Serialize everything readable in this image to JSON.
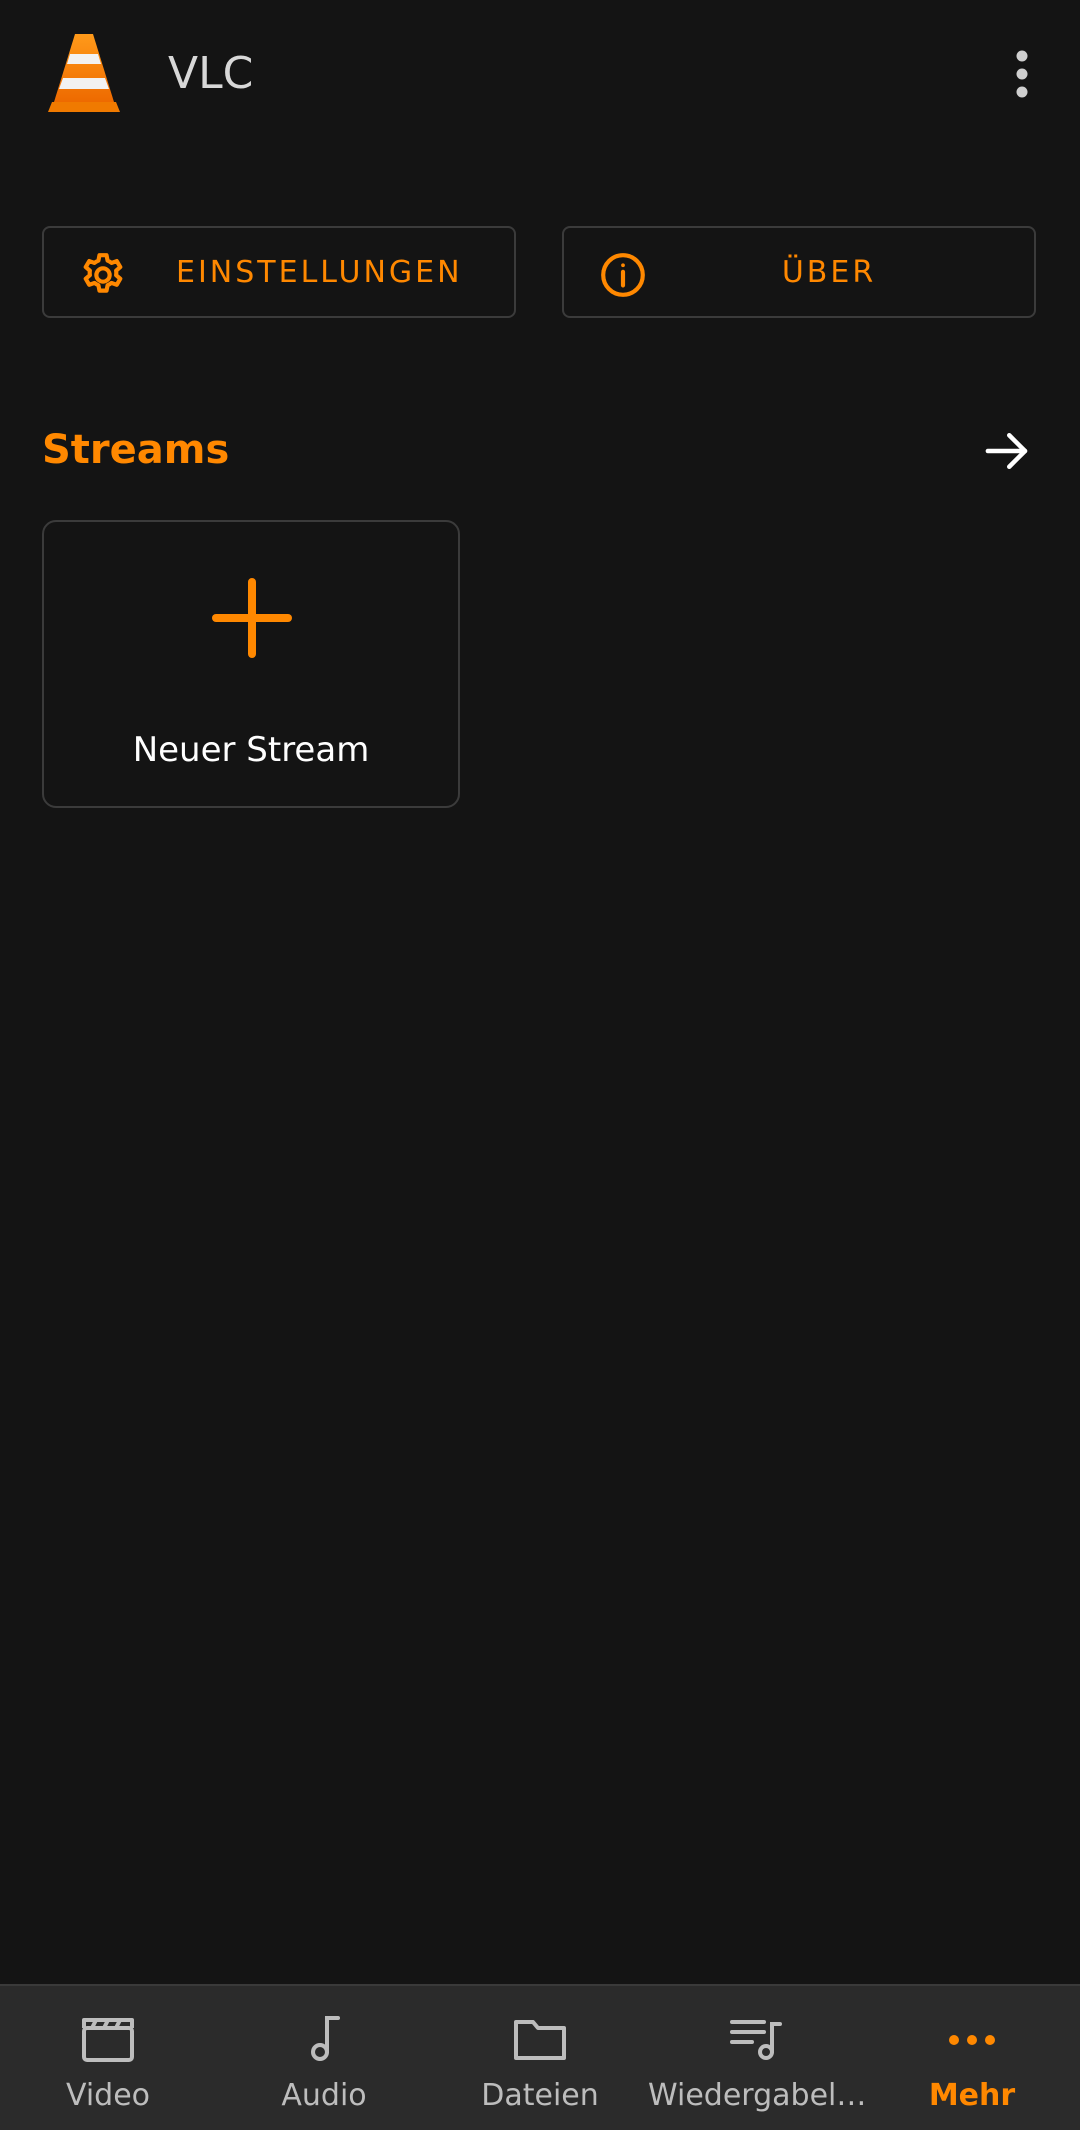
{
  "app_bar": {
    "title": "VLC",
    "logo_icon": "vlc-cone-icon",
    "menu_icon": "more-vert-icon"
  },
  "actions": {
    "settings": {
      "label": "EINSTELLUNGEN",
      "icon": "gear-icon"
    },
    "about": {
      "label": "ÜBER",
      "icon": "info-icon"
    }
  },
  "streams": {
    "title": "Streams",
    "arrow_icon": "arrow-right-icon",
    "new_stream": {
      "label": "Neuer Stream",
      "icon": "plus-icon"
    }
  },
  "bottom_nav": {
    "items": [
      {
        "label": "Video",
        "icon": "clapperboard-icon",
        "active": false
      },
      {
        "label": "Audio",
        "icon": "music-note-icon",
        "active": false
      },
      {
        "label": "Dateien",
        "icon": "folder-icon",
        "active": false
      },
      {
        "label": "Wiedergabel…",
        "icon": "playlist-icon",
        "active": false
      },
      {
        "label": "Mehr",
        "icon": "more-horiz-icon",
        "active": true
      }
    ]
  },
  "colors": {
    "accent": "#ff8800",
    "background": "#141414",
    "nav_background": "#2b2b2b",
    "border": "#3b3b3b"
  }
}
